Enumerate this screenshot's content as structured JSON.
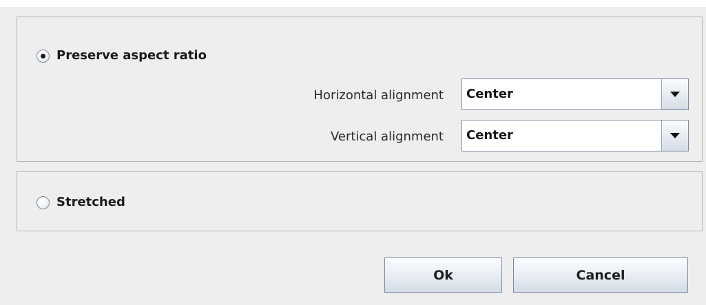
{
  "preserve_panel": {
    "radio_label": "Preserve aspect ratio",
    "selected": true,
    "horizontal": {
      "label": "Horizontal alignment",
      "value": "Center"
    },
    "vertical": {
      "label": "Vertical alignment",
      "value": "Center"
    }
  },
  "stretched_panel": {
    "radio_label": "Stretched",
    "selected": false
  },
  "buttons": {
    "ok_label": "Ok",
    "cancel_label": "Cancel"
  }
}
